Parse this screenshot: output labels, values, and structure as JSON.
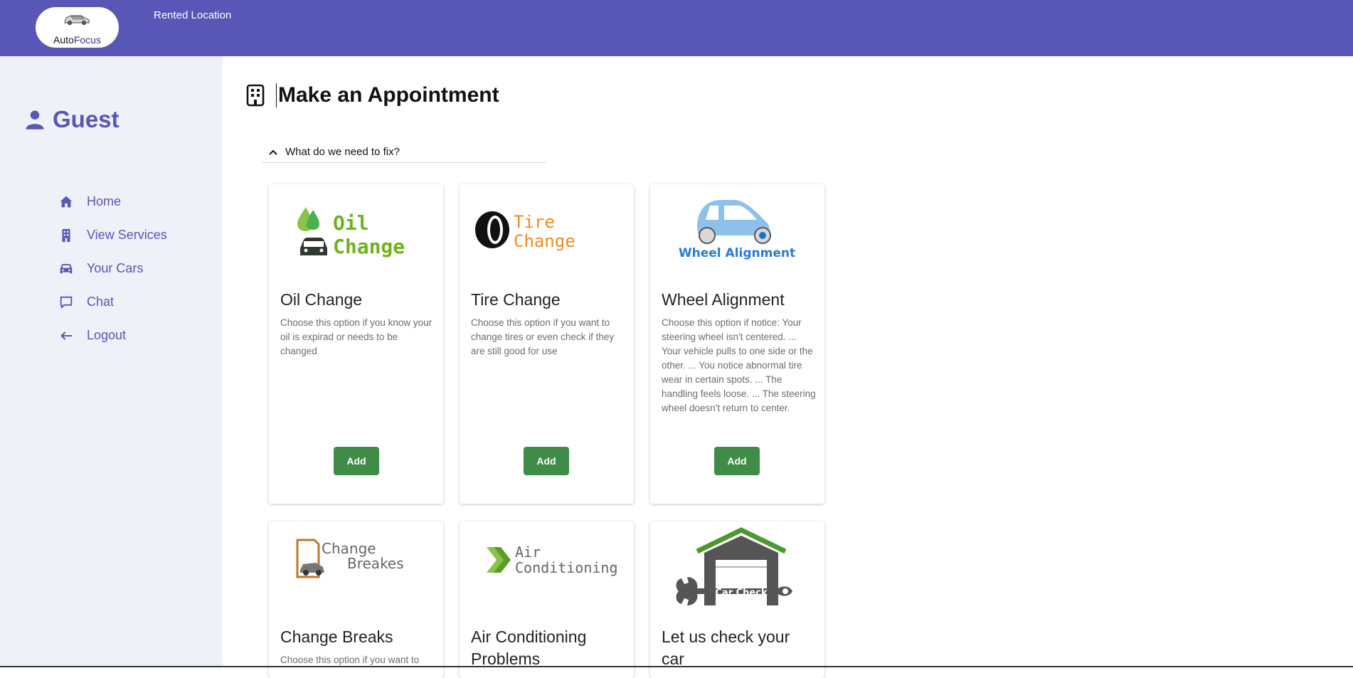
{
  "header": {
    "logo_text_1": "Auto",
    "logo_text_2": "Focus",
    "nav_link": "Rented Location",
    "bg_color": "#5856b6"
  },
  "sidebar": {
    "user_label": "Guest",
    "items": [
      {
        "label": "Home",
        "icon": "home-icon"
      },
      {
        "label": "View Services",
        "icon": "building-icon"
      },
      {
        "label": "Your Cars",
        "icon": "car-icon"
      },
      {
        "label": "Chat",
        "icon": "chat-icon"
      },
      {
        "label": "Logout",
        "icon": "arrow-left-icon"
      }
    ]
  },
  "main": {
    "title": "Make an Appointment",
    "section_label": "What do we need to fix?",
    "cards": [
      {
        "title": "Oil Change",
        "desc": "Choose this option if you know your oil is expirad or needs to be changed",
        "button": "Add",
        "image_text": [
          "Oil",
          "Change"
        ]
      },
      {
        "title": "Tire Change",
        "desc": "Choose this option if you want to change tires or even check if they are still good for use",
        "button": "Add",
        "image_text": [
          "Tire",
          "Change"
        ]
      },
      {
        "title": "Wheel Alignment",
        "desc": "Choose this option if notice: Your steering wheel isn't centered. ... Your vehicle pulls to one side or the other. ... You notice abnormal tire wear in certain spots. ... The handling feels loose. ... The steering wheel doesn't return to center.",
        "button": "Add",
        "image_text": [
          "Wheel Alignment"
        ]
      },
      {
        "title": "Change Breaks",
        "desc": "Choose this option if you want to",
        "image_text": [
          "Change",
          "Breakes"
        ]
      },
      {
        "title": "Air Conditioning Problems",
        "image_text": [
          "Air",
          "Conditioning"
        ]
      },
      {
        "title": "Let us check your car",
        "image_text": [
          "Car Check"
        ]
      }
    ]
  },
  "colors": {
    "accent": "#5856b6",
    "button": "#3e8c47",
    "sidebar_bg": "#eef1f7"
  }
}
